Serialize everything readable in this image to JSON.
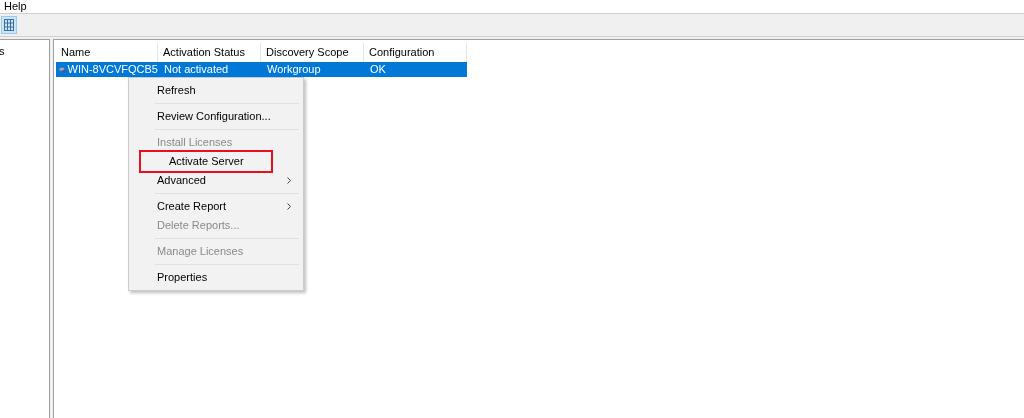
{
  "menu_bar": {
    "items": [
      "Help"
    ]
  },
  "tree": {
    "items": [
      "s"
    ]
  },
  "table": {
    "columns": [
      "Name",
      "Activation Status",
      "Discovery Scope",
      "Configuration"
    ],
    "rows": [
      {
        "cells": [
          "WIN-8VCVFQCB5",
          "Not activated",
          "Workgroup",
          "OK"
        ],
        "selected": true
      }
    ]
  },
  "context_menu": {
    "items": [
      {
        "kind": "item",
        "label": "Refresh",
        "disabled": false,
        "submenu": false,
        "highlighted": false
      },
      {
        "kind": "separator"
      },
      {
        "kind": "item",
        "label": "Review Configuration...",
        "disabled": false,
        "submenu": false,
        "highlighted": false
      },
      {
        "kind": "separator"
      },
      {
        "kind": "item",
        "label": "Install Licenses",
        "disabled": true,
        "submenu": false,
        "highlighted": false
      },
      {
        "kind": "item",
        "label": "Activate Server",
        "disabled": false,
        "submenu": false,
        "highlighted": true
      },
      {
        "kind": "item",
        "label": "Advanced",
        "disabled": false,
        "submenu": true,
        "highlighted": false
      },
      {
        "kind": "separator"
      },
      {
        "kind": "item",
        "label": "Create Report",
        "disabled": false,
        "submenu": true,
        "highlighted": false
      },
      {
        "kind": "item",
        "label": "Delete Reports...",
        "disabled": true,
        "submenu": false,
        "highlighted": false
      },
      {
        "kind": "separator"
      },
      {
        "kind": "item",
        "label": "Manage Licenses",
        "disabled": true,
        "submenu": false,
        "highlighted": false
      },
      {
        "kind": "separator"
      },
      {
        "kind": "item",
        "label": "Properties",
        "disabled": false,
        "submenu": false,
        "highlighted": false
      }
    ]
  }
}
